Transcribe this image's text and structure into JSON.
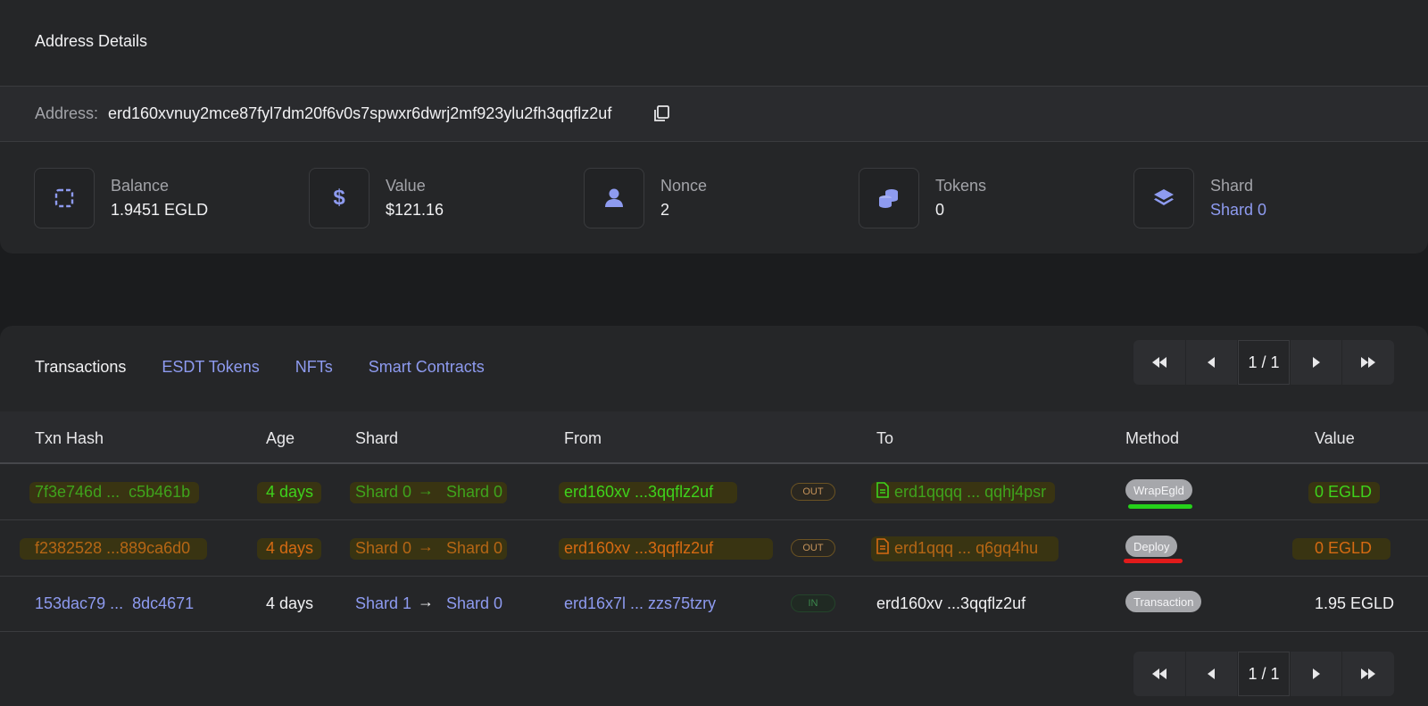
{
  "address_card": {
    "title": "Address Details",
    "address_label": "Address:",
    "address_value": "erd160xvnuy2mce87fyl7dm20f6v0s7spwxr6dwrj2mf923ylu2fh3qqflz2uf",
    "stats": [
      {
        "label": "Balance",
        "value": "1.9451 EGLD",
        "icon": "wallet-icon"
      },
      {
        "label": "Value",
        "value": "$121.16",
        "icon": "dollar-icon"
      },
      {
        "label": "Nonce",
        "value": "2",
        "icon": "user-icon"
      },
      {
        "label": "Tokens",
        "value": "0",
        "icon": "coins-icon"
      },
      {
        "label": "Shard",
        "value": "Shard 0",
        "icon": "layers-icon"
      }
    ]
  },
  "tabs": [
    "Transactions",
    "ESDT Tokens",
    "NFTs",
    "Smart Contracts"
  ],
  "pager": {
    "current": "1 / 1"
  },
  "table": {
    "headers": [
      "Txn Hash",
      "Age",
      "Shard",
      "From",
      "To",
      "Method",
      "Value"
    ],
    "rows": [
      {
        "hash_a": "7f3e746d ...",
        "hash_b": "c5b461b",
        "age": "4 days",
        "shard_from": "Shard 0",
        "shard_to": "Shard 0",
        "from": "erd160xv  ...3qqflz2uf",
        "direction": "OUT",
        "to": "erd1qqqq ... qqhj4psr",
        "method": "WrapEgld",
        "value": "0 EGLD"
      },
      {
        "hash_a": "f2382528 ...",
        "hash_b": "889ca6d0",
        "age": "4 days",
        "shard_from": "Shard 0",
        "shard_to": "Shard 0",
        "from": "erd160xv  ...3qqflz2uf",
        "direction": "OUT",
        "to": "erd1qqq  ...  q6gq4hu",
        "method": "Deploy",
        "value": "0 EGLD"
      },
      {
        "hash_a": "153dac79 ...",
        "hash_b": "8dc4671",
        "age": "4 days",
        "shard_from": "Shard 1",
        "shard_to": "Shard 0",
        "from": "erd16x7l  ...  zzs75tzry",
        "direction": "IN",
        "to": "erd160xv  ...3qqflz2uf",
        "method": "Transaction",
        "value": "1.95 EGLD"
      }
    ]
  },
  "colors": {
    "accent": "#8e9bf0",
    "highlight_green": "#3ed21c",
    "highlight_orange": "#d56a12",
    "underline_green": "#25d11a",
    "underline_red": "#e11b1b"
  }
}
